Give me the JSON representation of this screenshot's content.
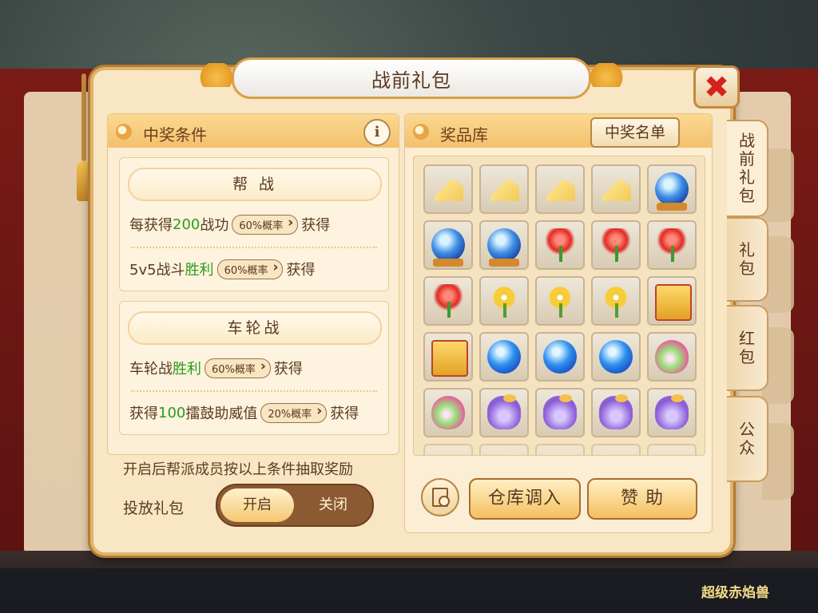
{
  "dialog": {
    "title": "战前礼包"
  },
  "left": {
    "header": "中奖条件",
    "info_icon": "i",
    "group1": {
      "title": "帮 战",
      "row1": {
        "pre": "每获得",
        "num": "200",
        "mid": "战功",
        "rate": "60%概率",
        "post": "获得"
      },
      "row2": {
        "pre": "5v5战斗",
        "hl": "胜利",
        "rate": "60%概率",
        "post": "获得"
      }
    },
    "group2": {
      "title": "车轮战",
      "row1": {
        "pre": "车轮战",
        "hl": "胜利",
        "rate": "60%概率",
        "post": "获得"
      },
      "row2": {
        "pre": "获得",
        "num": "100",
        "mid": "擂鼓助威值",
        "rate": "20%概率",
        "post": "获得"
      }
    },
    "note": "开启后帮派成员按以上条件抽取奖励",
    "toggle": {
      "label": "投放礼包",
      "on": "开启",
      "off": "关闭"
    }
  },
  "right": {
    "header": "奖品库",
    "winner_list": "中奖名单",
    "items": [
      "cheese",
      "cheese",
      "cheese",
      "cheese",
      "blue-orb-stand",
      "blue-orb-stand",
      "blue-orb-stand",
      "red-rose",
      "red-rose",
      "red-rose",
      "red-rose",
      "yellow-flower",
      "yellow-flower",
      "yellow-flower",
      "golden-hammer",
      "golden-hammer",
      "blue-orb",
      "blue-orb",
      "blue-orb",
      "rainbow-gourd",
      "rainbow-gourd",
      "purple-bag",
      "purple-bag",
      "purple-bag",
      "purple-bag"
    ],
    "store_button": "仓库调入",
    "sponsor_button": "赞 助"
  },
  "tabs": [
    {
      "label": "战前礼包",
      "active": true
    },
    {
      "label": "礼包",
      "active": false
    },
    {
      "label": "红包",
      "active": false
    },
    {
      "label": "公众",
      "active": false
    }
  ],
  "background": {
    "bottom_text": "超级赤焰兽"
  },
  "colors": {
    "highlight_green": "#2d9b1f",
    "close_red": "#d4231f",
    "panel_bg": "#fbeed4"
  }
}
